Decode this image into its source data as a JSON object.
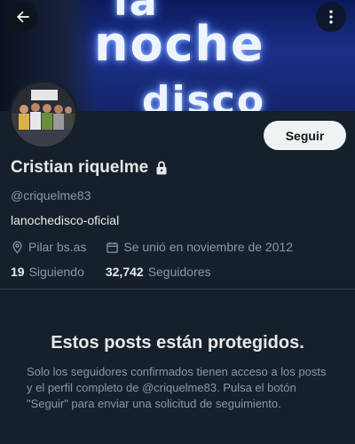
{
  "header": {
    "banner_sign_lines": [
      "la",
      "noche",
      "disco"
    ]
  },
  "profile": {
    "follow_label": "Seguir",
    "name": "Cristian riquelme",
    "handle": "@criquelme83",
    "bio": "lanochedisco-oficial",
    "location": "Pilar bs.as",
    "joined": "Se unió en noviembre de 2012",
    "following_count": "19",
    "following_label": "Siguiendo",
    "followers_count": "32,742",
    "followers_label": "Seguidores"
  },
  "protected": {
    "title": "Estos posts están protegidos.",
    "body": "Solo los seguidores confirmados tienen acceso a los posts y el perfil completo de @criquelme83. Pulsa el botón \"Seguir\" para enviar una solicitud de seguimiento."
  },
  "icons": {
    "back": "arrow-left-icon",
    "more": "more-vertical-icon",
    "lock": "lock-icon",
    "location": "location-pin-icon",
    "calendar": "calendar-icon"
  },
  "colors": {
    "background": "#15202b",
    "text_primary": "#e7e9ea",
    "text_secondary": "#8b98a5",
    "button_bg": "#eff3f4"
  }
}
